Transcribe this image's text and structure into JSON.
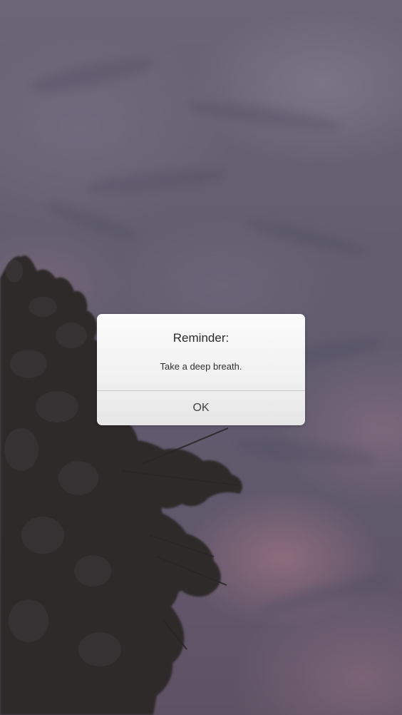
{
  "alert": {
    "title": "Reminder:",
    "message": "Take a deep breath.",
    "button_label": "OK"
  },
  "background": {
    "subject": "cloudy dusk sky with tree",
    "colors": {
      "sky": "#625e6f",
      "sky_pink": "#a87a8c",
      "tree": "#2e2a2b"
    }
  }
}
